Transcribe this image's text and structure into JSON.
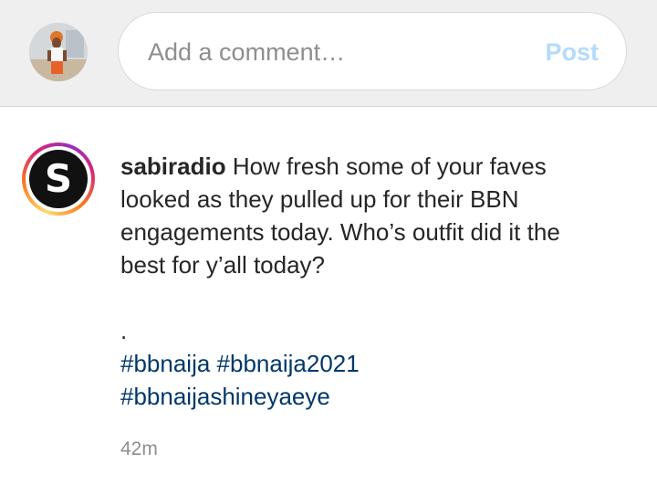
{
  "comment_bar": {
    "avatar_icon": "user-profile-photo",
    "placeholder": "Add a comment…",
    "post_label": "Post",
    "post_color": "#b3dbfb"
  },
  "post": {
    "avatar_letter": "S",
    "avatar_icon": "sabiradio-logo",
    "username": "sabiradio",
    "caption": " How fresh some of your faves looked as they pulled up for their BBN engagements today. Who’s outfit did it the best for y’all today?",
    "separator": ".",
    "hashtags": [
      "#bbnaija",
      "#bbnaija2021",
      "#bbnaijashineyaeye"
    ],
    "hashtag_color": "#00376b",
    "timestamp": "42m"
  }
}
